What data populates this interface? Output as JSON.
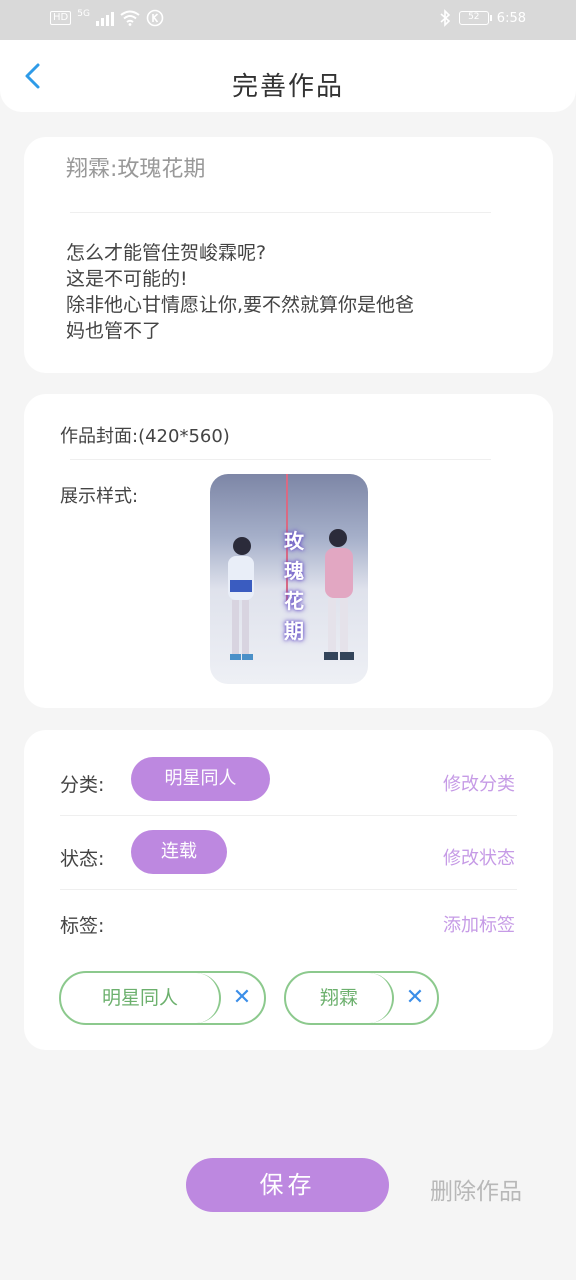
{
  "statusbar": {
    "hd": "HD",
    "net": "5G",
    "battery": "52",
    "time": "6:58"
  },
  "header": {
    "title": "完善作品"
  },
  "work": {
    "title": "翔霖:玫瑰花期",
    "desc_lines": [
      "怎么才能管住贺峻霖呢?",
      "这是不可能的!",
      "除非他心甘情愿让你,要不然就算你是他爸",
      "妈也管不了"
    ]
  },
  "cover": {
    "label": "作品封面:(420*560)",
    "display_label": "展示样式:",
    "image_text": [
      "玫",
      "瑰",
      "花",
      "期"
    ]
  },
  "meta": {
    "category_label": "分类:",
    "category_value": "明星同人",
    "category_action": "修改分类",
    "status_label": "状态:",
    "status_value": "连载",
    "status_action": "修改状态",
    "tags_label": "标签:",
    "tags_action": "添加标签",
    "tags": [
      "明星同人",
      "翔霖"
    ],
    "remove_symbol": "✕"
  },
  "footer": {
    "save_label": "保存",
    "delete_label": "删除作品"
  },
  "colors": {
    "accent": "#bd88e0",
    "tag_border": "#8cc98d",
    "remove": "#3b8ee8",
    "back": "#2e9be8"
  }
}
